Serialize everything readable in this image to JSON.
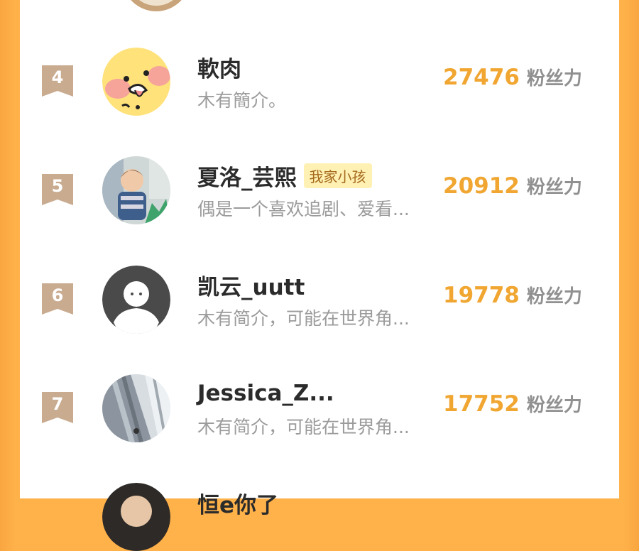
{
  "ranking": {
    "score_unit": "粉丝力",
    "rows": [
      {
        "rank": "4",
        "name": "軟肉",
        "tag": "",
        "bio": "木有簡介。",
        "score": "27476",
        "avatar": "cartoon-face-avatar"
      },
      {
        "rank": "5",
        "name": "夏洛_芸熙",
        "tag": "我家小孩",
        "bio": "偶是一个喜欢追剧、爱看...",
        "score": "20912",
        "avatar": "child-photo-avatar"
      },
      {
        "rank": "6",
        "name": "凯云_uutt",
        "tag": "",
        "bio": "木有简介，可能在世界角...",
        "score": "19778",
        "avatar": "default-user-avatar"
      },
      {
        "rank": "7",
        "name": "Jessica_Z...",
        "tag": "",
        "bio": "木有简介，可能在世界角...",
        "score": "17752",
        "avatar": "architecture-photo-avatar"
      }
    ],
    "next_partial_name": "恒e你了"
  },
  "colors": {
    "background_orange": "#ffb24a",
    "score_orange": "#f0a631",
    "badge_tan": "#c9ab90",
    "tag_bg": "#fff0b3",
    "tag_text": "#a46a1d"
  }
}
